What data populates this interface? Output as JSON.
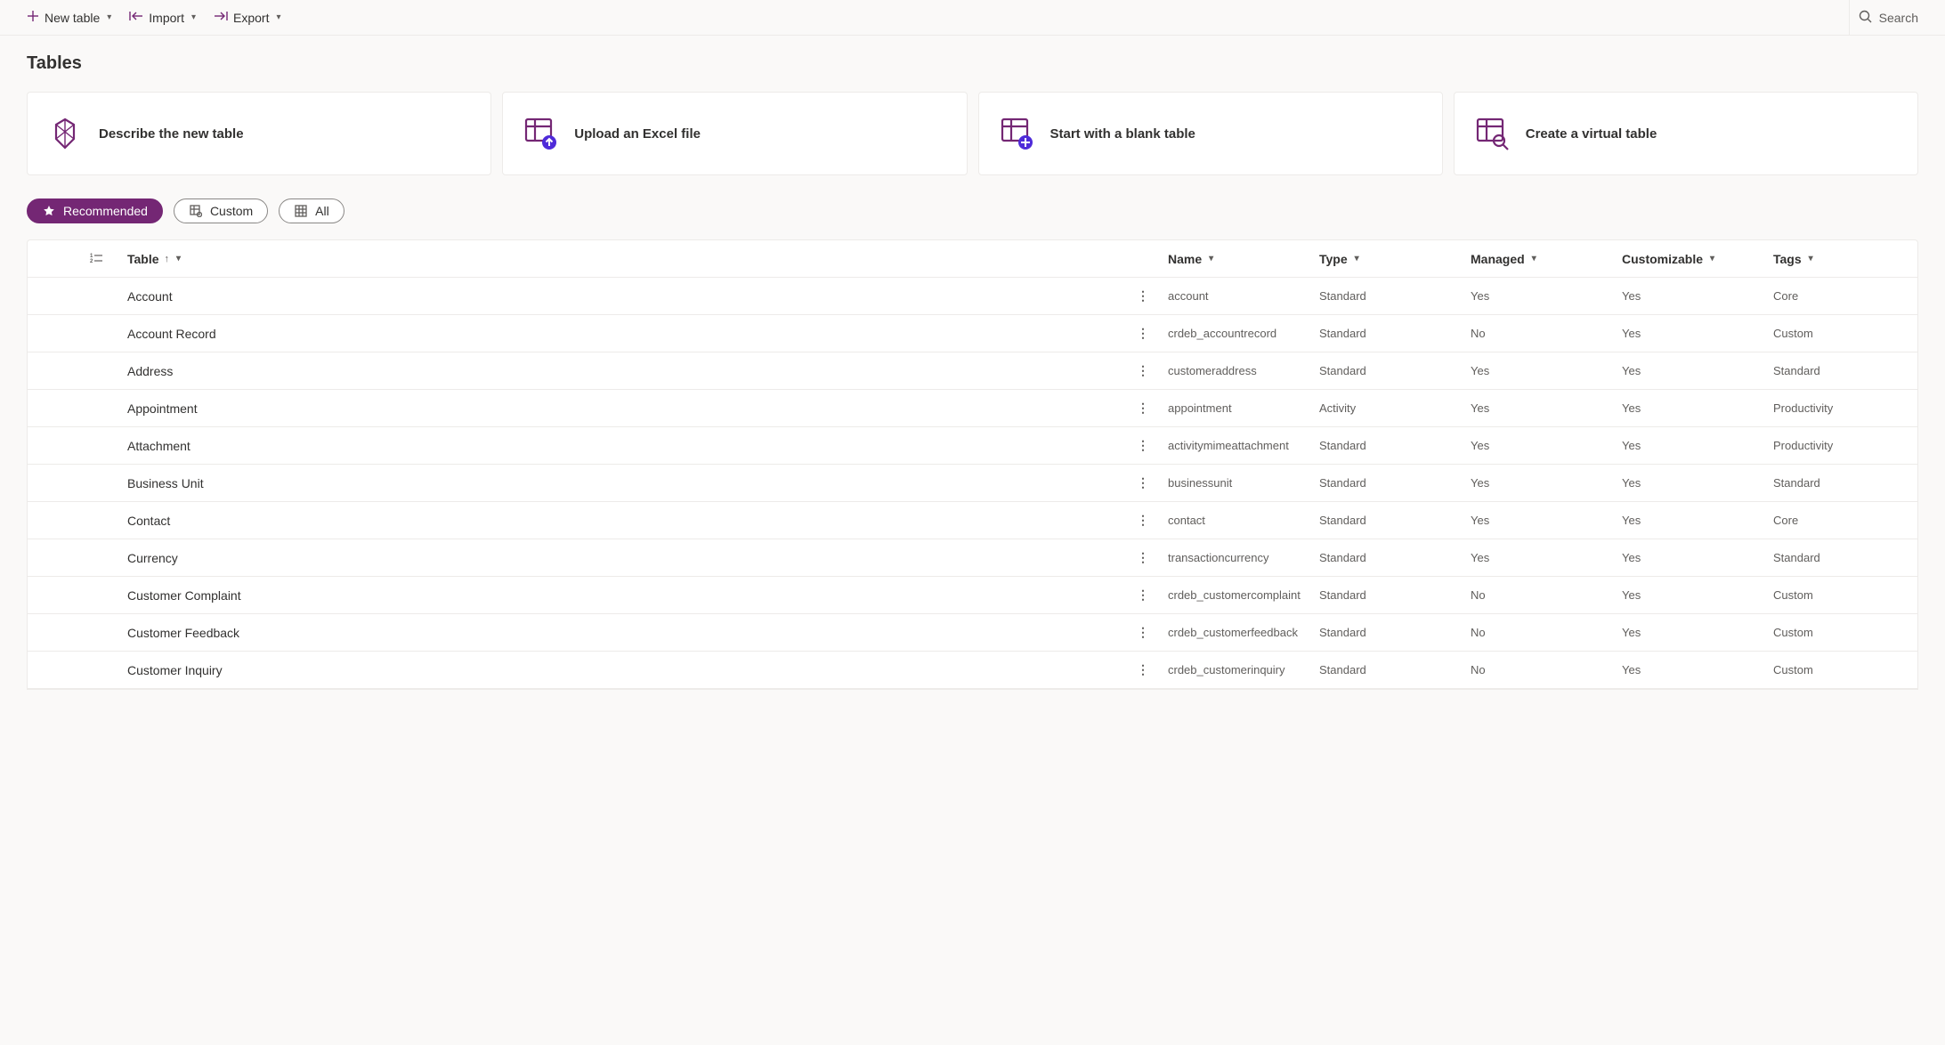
{
  "commandbar": {
    "new_table": "New table",
    "import": "Import",
    "export": "Export",
    "search": "Search"
  },
  "page_title": "Tables",
  "cards": [
    {
      "label": "Describe the new table"
    },
    {
      "label": "Upload an Excel file"
    },
    {
      "label": "Start with a blank table"
    },
    {
      "label": "Create a virtual table"
    }
  ],
  "filters": {
    "recommended": "Recommended",
    "custom": "Custom",
    "all": "All"
  },
  "columns": {
    "table": "Table",
    "name": "Name",
    "type": "Type",
    "managed": "Managed",
    "customizable": "Customizable",
    "tags": "Tags"
  },
  "rows": [
    {
      "table": "Account",
      "name": "account",
      "type": "Standard",
      "managed": "Yes",
      "customizable": "Yes",
      "tags": "Core"
    },
    {
      "table": "Account Record",
      "name": "crdeb_accountrecord",
      "type": "Standard",
      "managed": "No",
      "customizable": "Yes",
      "tags": "Custom"
    },
    {
      "table": "Address",
      "name": "customeraddress",
      "type": "Standard",
      "managed": "Yes",
      "customizable": "Yes",
      "tags": "Standard"
    },
    {
      "table": "Appointment",
      "name": "appointment",
      "type": "Activity",
      "managed": "Yes",
      "customizable": "Yes",
      "tags": "Productivity"
    },
    {
      "table": "Attachment",
      "name": "activitymimeattachment",
      "type": "Standard",
      "managed": "Yes",
      "customizable": "Yes",
      "tags": "Productivity"
    },
    {
      "table": "Business Unit",
      "name": "businessunit",
      "type": "Standard",
      "managed": "Yes",
      "customizable": "Yes",
      "tags": "Standard"
    },
    {
      "table": "Contact",
      "name": "contact",
      "type": "Standard",
      "managed": "Yes",
      "customizable": "Yes",
      "tags": "Core"
    },
    {
      "table": "Currency",
      "name": "transactioncurrency",
      "type": "Standard",
      "managed": "Yes",
      "customizable": "Yes",
      "tags": "Standard"
    },
    {
      "table": "Customer Complaint",
      "name": "crdeb_customercomplaint",
      "type": "Standard",
      "managed": "No",
      "customizable": "Yes",
      "tags": "Custom"
    },
    {
      "table": "Customer Feedback",
      "name": "crdeb_customerfeedback",
      "type": "Standard",
      "managed": "No",
      "customizable": "Yes",
      "tags": "Custom"
    },
    {
      "table": "Customer Inquiry",
      "name": "crdeb_customerinquiry",
      "type": "Standard",
      "managed": "No",
      "customizable": "Yes",
      "tags": "Custom"
    }
  ]
}
